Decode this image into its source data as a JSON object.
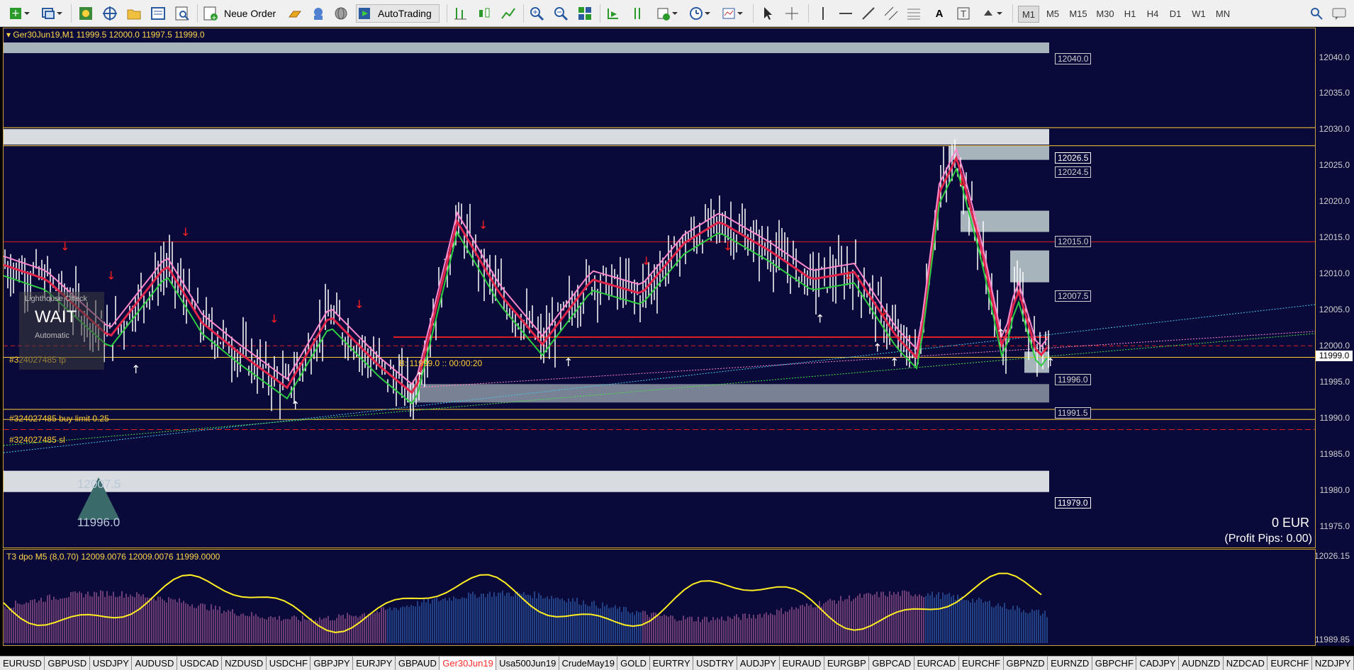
{
  "toolbar": {
    "new_order_label": "Neue Order",
    "autotrading_label": "AutoTrading",
    "timeframes": [
      "M1",
      "M5",
      "M15",
      "M30",
      "H1",
      "H4",
      "D1",
      "W1",
      "MN"
    ],
    "active_timeframe": "M1"
  },
  "chart": {
    "header": "Ger30Jun19,M1  11999.5 12000.0 11997.5 11999.0",
    "price_labels": [
      "12040.0",
      "12035.0",
      "12030.0",
      "12025.0",
      "12020.0",
      "12015.0",
      "12010.0",
      "12005.0",
      "12000.0",
      "11995.0",
      "11990.0",
      "11985.0",
      "11980.0",
      "11975.0"
    ],
    "current_price": "11999.0",
    "orders": {
      "tp_label": "#324027485 tp",
      "buy_label": "#324027485 buy limit 0.25",
      "sl_label": "#324027485 sl",
      "bid_label": "B: 11999.0 :: 00:00:20"
    },
    "zone_labels": [
      "12040.0",
      "12026.5",
      "12024.5",
      "12015.0",
      "12007.5",
      "11996.0",
      "11991.5",
      "11979.0"
    ],
    "lighthouse": {
      "title": "Lighthouse Check",
      "status": "WAIT",
      "mode": "Automatic"
    },
    "triangle": {
      "top": "12007.5",
      "bottom": "11996.0"
    },
    "profit": {
      "amount": "0 EUR",
      "pips": "(Profit Pips: 0.00)"
    }
  },
  "indicator": {
    "header": "T3 dpo M5 (8,0.70) 12009.0076 12009.0076 11999.0000",
    "axis_top": "12026.15",
    "axis_bottom": "11989.85"
  },
  "tabs": [
    "EURUSD",
    "GBPUSD",
    "USDJPY",
    "AUDUSD",
    "USDCAD",
    "NZDUSD",
    "USDCHF",
    "GBPJPY",
    "EURJPY",
    "GBPAUD",
    "Ger30Jun19",
    "Usa500Jun19",
    "CrudeMay19",
    "GOLD",
    "EURTRY",
    "USDTRY",
    "AUDJPY",
    "EURAUD",
    "EURGBP",
    "GBPCAD",
    "EURCAD",
    "EURCHF",
    "GBPNZD",
    "EURNZD",
    "GBPCHF",
    "CADJPY",
    "AUDNZD",
    "NZDCAD",
    "EURCHF",
    "NZDJPY"
  ],
  "active_tab": "Ger30Jun19",
  "colors": {
    "background": "#0a0a3a",
    "bull": "#ffffff",
    "ema_up": "#4a6fe0",
    "ema_down": "#e0244a",
    "ema_slow": "#2ecc40",
    "pink": "#ff88cc",
    "order_line": "#ffcc33"
  }
}
